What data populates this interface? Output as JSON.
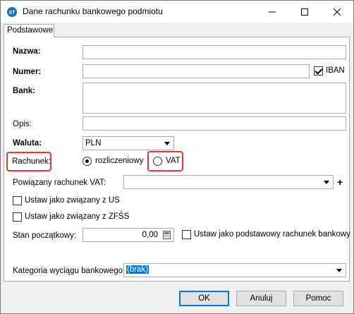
{
  "window": {
    "title": "Dane rachunku bankowego podmiotu"
  },
  "tabs": [
    {
      "label": "Podstawowe"
    }
  ],
  "form": {
    "nazwa_label": "Nazwa:",
    "numer_label": "Numer:",
    "iban_label": "IBAN",
    "bank_label": "Bank:",
    "opis_label": "Opis:",
    "waluta_label": "Waluta:",
    "waluta_value": "PLN",
    "rachunek_label": "Rachunek:",
    "rachunek_options": [
      "rozliczeniowy",
      "VAT"
    ],
    "powiazany_label": "Powiązany rachunek VAT:",
    "us_label": "Ustaw jako związany z US",
    "zfss_label": "Ustaw jako związany z ZFŚS",
    "stan_label": "Stan początkowy:",
    "stan_value": "0,00",
    "podstawowy_label": "Ustaw jako podstawowy rachunek bankowy",
    "kategoria_label": "Kategoria wyciągu bankowego:",
    "kategoria_value": "(brak)"
  },
  "buttons": {
    "ok": "OK",
    "cancel": "Anuluj",
    "help": "Pomoc"
  },
  "colors": {
    "highlight": "#e53935",
    "selection": "#0078d7"
  }
}
